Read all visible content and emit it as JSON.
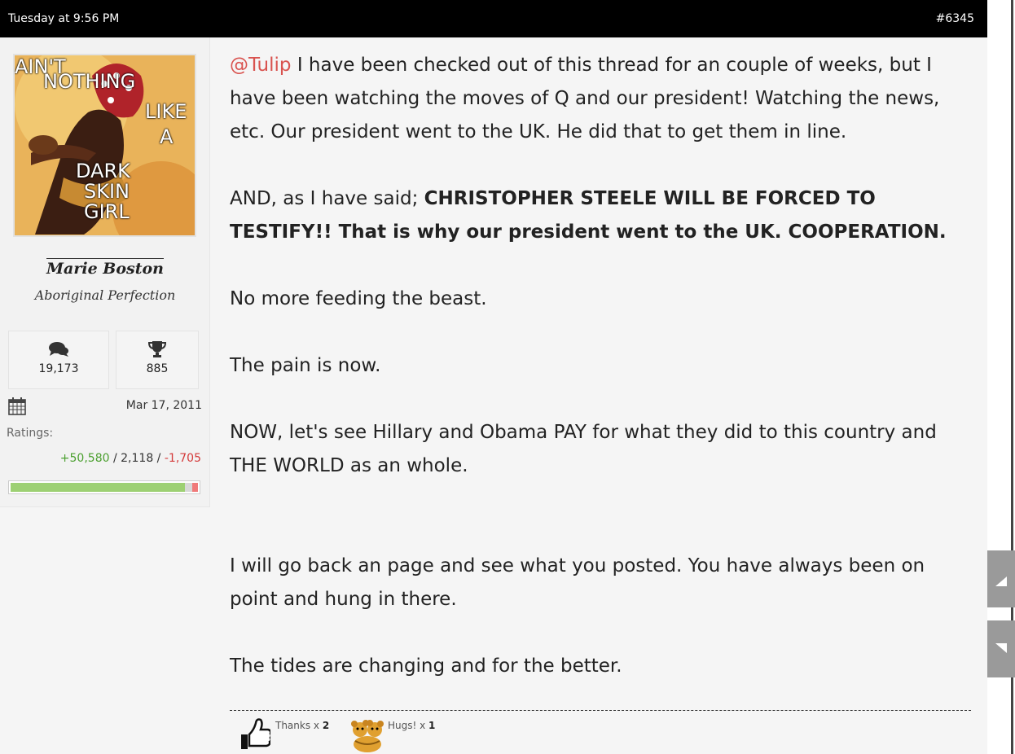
{
  "header": {
    "timestamp": "Tuesday at 9:56 PM",
    "post_number": "#6345"
  },
  "user": {
    "avatar_text": [
      "AIN'T",
      "NOTHING",
      "LIKE",
      "A",
      "DARK",
      "SKIN",
      "GIRL"
    ],
    "name": "Marie Boston",
    "title": "Aboriginal Perfection",
    "messages_icon": "speech-bubbles-icon",
    "messages": "19,173",
    "trophy_icon": "trophy-icon",
    "trophies": "885",
    "joined_icon": "calendar-icon",
    "joined": "Mar 17, 2011",
    "ratings_label": "Ratings:",
    "ratings_positive": "+50,580",
    "ratings_neutral": "2,118",
    "ratings_negative": "-1,705",
    "sep": " / ",
    "rating_fractions": {
      "positive": 0.93,
      "neutral": 0.04,
      "negative": 0.03
    }
  },
  "post": {
    "mention": "@Tulip",
    "p1": " I have been checked out of this thread for an couple of weeks, but I have been watching the moves of Q and our president! Watching the news, etc. Our president went to the UK. He did that to get them in line.",
    "p2_prefix": "AND, as I have said; ",
    "p2_bold": "CHRISTOPHER STEELE WILL BE FORCED TO TESTIFY!! That is why our president went to the UK. COOPERATION.",
    "p3": "No more feeding the beast.",
    "p4": "The pain is now.",
    "p5": "NOW, let's see Hillary and Obama PAY for what they did to this country and THE WORLD as an whole.",
    "p6": "I will go back an page and see what you posted. You have always been on point and hung in there.",
    "p7": "The tides are changing and for the better."
  },
  "reactions": [
    {
      "icon": "thumbs-up-icon",
      "label": "Thanks",
      "x": " x ",
      "count": "2"
    },
    {
      "icon": "hugging-bears-icon",
      "label": "Hugs!",
      "x": " x ",
      "count": "1"
    }
  ],
  "colors": {
    "header_bg": "#000000",
    "mention": "#d9534f",
    "positive": "#4a9f2e",
    "negative": "#d43a3a"
  },
  "scroll": {
    "up_icon": "chevron-up-icon",
    "down_icon": "chevron-down-icon"
  }
}
